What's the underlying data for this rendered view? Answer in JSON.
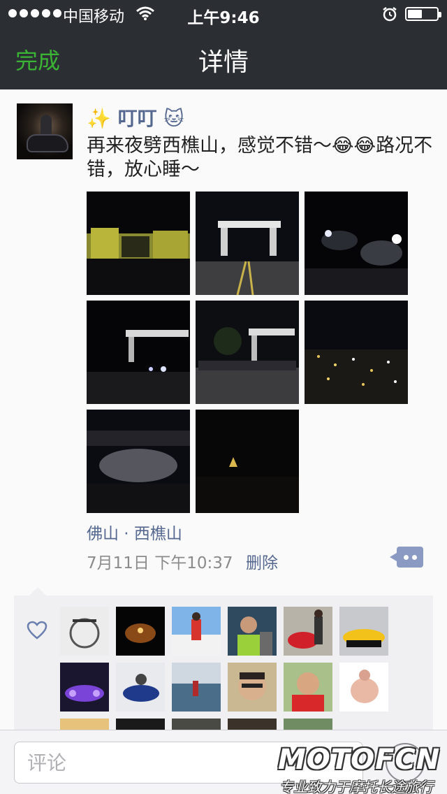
{
  "status_bar": {
    "carrier": "中国移动",
    "time": "上午9:46"
  },
  "nav": {
    "done_label": "完成",
    "title": "详情"
  },
  "post": {
    "username": "✨ 叮叮 🐱",
    "text": "再来夜劈西樵山，感觉不错～😂😂路况不错，放心睡～",
    "photo_count": 8,
    "location": "佛山 · 西樵山",
    "timestamp": "7月11日 下午10:37",
    "delete_label": "删除"
  },
  "likes": {
    "avatar_count": 17
  },
  "comment": {
    "placeholder": "评论"
  },
  "watermark": {
    "brand": "MOTOFCN",
    "slogan": "专业致力于摩托长途旅行"
  },
  "colors": {
    "nav_bg": "#2b2e32",
    "done": "#3bb335",
    "link": "#556890"
  }
}
